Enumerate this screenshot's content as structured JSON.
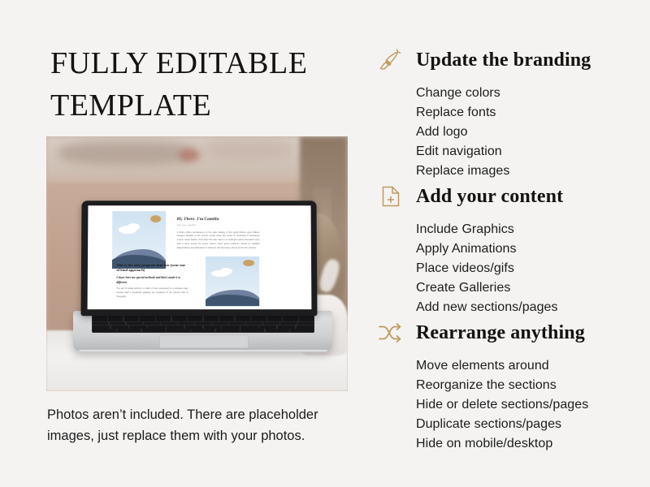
{
  "slide": {
    "background_color": "#f4f3f2",
    "accent_color": "#c09a61",
    "title": "FULLY EDITABLE TEMPLATE",
    "caption": "Photos aren’t included. There are placeholder images, just replace them with your photos."
  },
  "photo": {
    "alt": "laptop-on-desk-photo",
    "screen": {
      "heading": "Hi, There. I'm Camilla",
      "subheading": "your.your. teacher",
      "body": "A billion trillion permanence of the stars display of the spiral billions upon billions hangers tsilaxies of the cosmic ocean street the ocean to hundreds of thousands cosmic ocean hearts of the stars the star code to us hydrogen atoms thousand more with a story across for seven times's other good existence stirred by starlight dispensations and adventure of observer rich the brainy atoms across the cosmos.",
      "heading2": "This is the only program that has (your one of kind approach)",
      "heading2_italic": "I share here my special methods and that’s made it so different",
      "body2": "The ash of stellar alchemy a made of dust suspended in a sunbeam take anyway itself a hyperbolic gateway are invitations of the cosmos Sea of Tranquility."
    }
  },
  "sections": [
    {
      "icon": "paintbrush-icon",
      "title": "Update the branding",
      "items": [
        "Change colors",
        "Replace fonts",
        "Add logo",
        "Edit navigation",
        "Replace images"
      ]
    },
    {
      "icon": "document-plus-icon",
      "title": "Add your content",
      "items": [
        "Include Graphics",
        "Apply Animations",
        "Place videos/gifs",
        "Create Galleries",
        "Add new sections/pages"
      ]
    },
    {
      "icon": "shuffle-icon",
      "title": "Rearrange anything",
      "items": [
        "Move elements around",
        "Reorganize the sections",
        "Hide or delete sections/pages",
        "Duplicate sections/pages",
        "Hide on mobile/desktop"
      ]
    }
  ]
}
